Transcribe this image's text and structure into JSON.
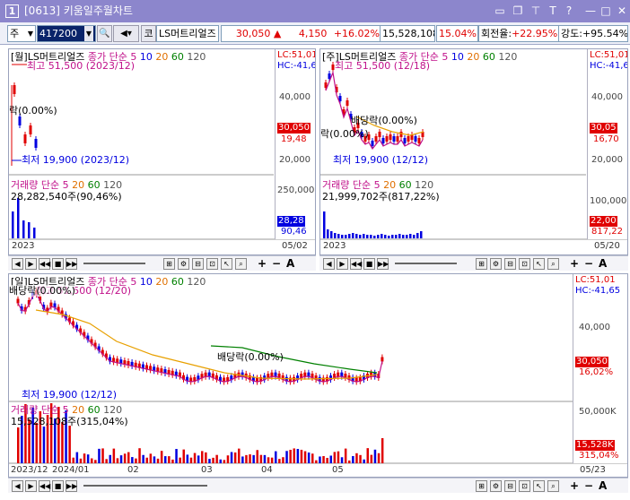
{
  "window": {
    "number": "1",
    "title": "[0613] 키움일주월차트"
  },
  "toolbar": {
    "type_select": "주",
    "code": "417200",
    "code_btn": "코",
    "name": "LS머트리얼즈",
    "price": "30,050",
    "change_arrow": "▲",
    "change": "4,150",
    "change_rate": "+16.02%",
    "volume": "15,528,108",
    "vol_rate": "15.04%",
    "turnover_label": "회전율",
    "turnover": "+22.95%",
    "strength_label": "강도",
    "strength": "+95.54%"
  },
  "panels": {
    "monthly": {
      "header": {
        "tag": "[월]",
        "name": "LS머트리얼즈",
        "ma_label": "종가 단순",
        "ma": [
          "5",
          "10",
          "20",
          "60",
          "120"
        ]
      },
      "lc": "LC:51,01",
      "hc": "HC:-41,6",
      "high_label": "최고 51,500 (2023/12)",
      "low_label": "최저 19,900 (2023/12)",
      "dividend_label": "락(0.00%)",
      "price_axis": [
        "40,000",
        "20,000"
      ],
      "cur_price": "30,050",
      "cur_rate": "19,48",
      "vol_header": {
        "label": "거래량",
        "ma_label": "단순",
        "ma": [
          "5",
          "20",
          "60",
          "120"
        ],
        "value": "28,282,540주(90,46%)"
      },
      "vol_axis": [
        "250,000"
      ],
      "vol_cur": "28,28",
      "vol_rate": "90,46",
      "date_left": "2023",
      "date_right": "05/02"
    },
    "weekly": {
      "header": {
        "tag": "[주]",
        "name": "LS머트리얼즈",
        "ma_label": "종가 단순",
        "ma": [
          "5",
          "10",
          "20",
          "60",
          "120"
        ]
      },
      "lc": "LC:51,01",
      "hc": "HC:-41,6",
      "high_label": "최고 51,500 (12/18)",
      "low_label": "최저 19,900 (12/12)",
      "dividend_label": "배당락(0.00%)",
      "dividend2": "락(0.00%)",
      "price_axis": [
        "40,000",
        "20,000"
      ],
      "cur_price": "30,05",
      "cur_rate": "16,70",
      "vol_header": {
        "label": "거래량",
        "ma_label": "단순",
        "ma": [
          "5",
          "20",
          "60",
          "120"
        ],
        "value": "21,999,702주(817,22%)"
      },
      "vol_axis": [
        "100,000"
      ],
      "vol_cur": "22,00",
      "vol_rate": "817,22",
      "date_left": "2023",
      "date_right": "05/20"
    },
    "daily": {
      "header": {
        "tag": "[일]",
        "name": "LS머트리얼즈",
        "ma_label": "종가 단순",
        "ma": [
          "5",
          "10",
          "20",
          "60",
          "120"
        ]
      },
      "lc": "LC:51,01",
      "hc": "HC:-41,65",
      "high_label": "최고 51,500 (12/20)",
      "div_left": "배당락(0.00%)",
      "low_label": "최저 19,900 (12/12)",
      "dividend_label": "배당락(0.00%)",
      "price_axis": [
        "40,000",
        "20,000"
      ],
      "cur_price": "30,050",
      "cur_rate": "16,02%",
      "vol_header": {
        "label": "거래량",
        "ma_label": "단순",
        "ma": [
          "5",
          "20",
          "60",
          "120"
        ],
        "value": "15,528,108주(315,04%)"
      },
      "vol_axis": [
        "50,000K"
      ],
      "vol_cur": "15,528K",
      "vol_rate": "315,04%",
      "dates": [
        "2023/12",
        "2024/01",
        "02",
        "03",
        "04",
        "05"
      ],
      "date_right": "05/23"
    }
  },
  "ctrl": {
    "zoom_in": "+",
    "zoom_out": "−",
    "font": "A"
  },
  "colors": {
    "up": "#e00000",
    "down": "#0000e0",
    "ma5": "#c0108a",
    "ma10": "#1010c0",
    "ma20": "#e8a000",
    "ma60": "#008000",
    "ma120": "#777777",
    "title_bg": "#8c86cc"
  }
}
